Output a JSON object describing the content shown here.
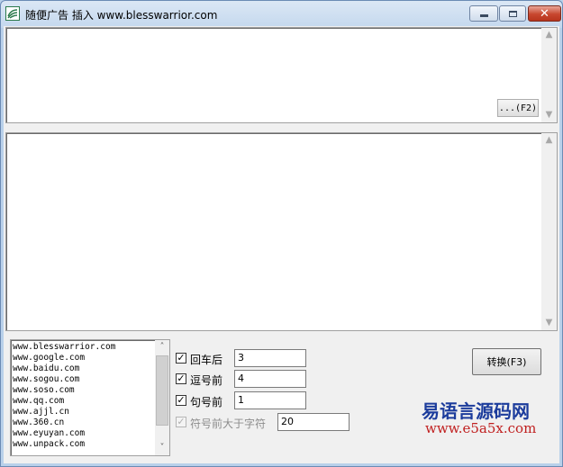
{
  "window": {
    "title": "随便广告 插入 www.blesswarrior.com",
    "controls": {
      "minimize": "minimize",
      "maximize": "maximize",
      "close": "✕"
    }
  },
  "top_editor": {
    "value": "",
    "button_label": "...(F2)"
  },
  "main_editor": {
    "value": ""
  },
  "domain_list": {
    "items": [
      "www.blesswarrior.com",
      "www.google.com",
      "www.baidu.com",
      "www.sogou.com",
      "www.soso.com",
      "www.qq.com",
      "www.ajjl.cn",
      "www.360.cn",
      "www.eyuyan.com",
      "www.unpack.com"
    ]
  },
  "options": [
    {
      "label": "回车后",
      "checked": true,
      "enabled": true,
      "value": "3"
    },
    {
      "label": "逗号前",
      "checked": true,
      "enabled": true,
      "value": "4"
    },
    {
      "label": "句号前",
      "checked": true,
      "enabled": true,
      "value": "1"
    },
    {
      "label": "符号前大于字符",
      "checked": true,
      "enabled": false,
      "value": "20"
    }
  ],
  "convert_button": {
    "label": "转换(F3)"
  },
  "watermark": {
    "line1": "易语言源码网",
    "line2": "www.e5a5x.com"
  }
}
